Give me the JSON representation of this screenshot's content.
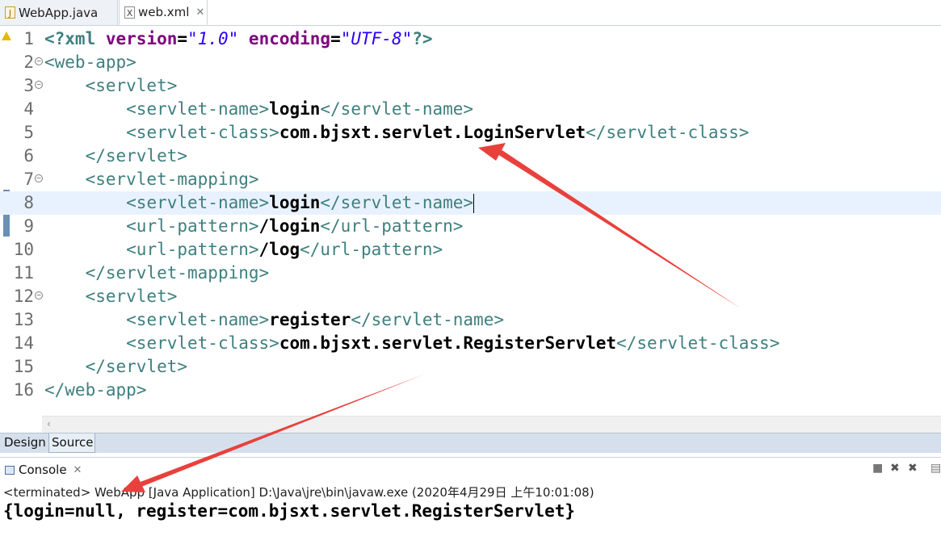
{
  "tabs": [
    {
      "label": "WebApp.java",
      "icon": "java-file-icon"
    },
    {
      "label": "web.xml",
      "icon": "xml-file-icon",
      "close": "✕"
    }
  ],
  "editor": {
    "lines": [
      {
        "num": "1",
        "html": "<span class=\"pi\">&lt;?xml</span> <span class=\"an\">version</span><span class=\"eq\">=</span><span class=\"av\">\"1.0\"</span> <span class=\"an\">encoding</span><span class=\"eq\">=</span><span class=\"av\">\"UTF-8\"</span><span class=\"pi\">?&gt;</span>"
      },
      {
        "num": "2",
        "fold": true,
        "html": "<span class=\"tg\">&lt;web-app&gt;</span>"
      },
      {
        "num": "3",
        "fold": true,
        "html": "    <span class=\"tg\">&lt;servlet&gt;</span>"
      },
      {
        "num": "4",
        "html": "        <span class=\"tg\">&lt;servlet-name&gt;</span><span class=\"tx\">login</span><span class=\"tg\">&lt;/servlet-name&gt;</span>"
      },
      {
        "num": "5",
        "html": "        <span class=\"tg\">&lt;servlet-class&gt;</span><span class=\"tx\">com.bjsxt.servlet.LoginServlet</span><span class=\"tg\">&lt;/servlet-class&gt;</span>"
      },
      {
        "num": "6",
        "html": "    <span class=\"tg\">&lt;/servlet&gt;</span>"
      },
      {
        "num": "7",
        "fold": true,
        "html": "    <span class=\"tg\">&lt;servlet-mapping&gt;</span>"
      },
      {
        "num": "8",
        "highlight": true,
        "html": "        <span class=\"tg\">&lt;servlet-name&gt;</span><span class=\"tx\">login</span><span class=\"tg\">&lt;/servlet-name&gt;</span><span class=\"cursor\"></span>"
      },
      {
        "num": "9",
        "html": "        <span class=\"tg\">&lt;url-pattern&gt;</span><span class=\"tx\">/login</span><span class=\"tg\">&lt;/url-pattern&gt;</span>"
      },
      {
        "num": "10",
        "html": "        <span class=\"tg\">&lt;url-pattern&gt;</span><span class=\"tx\">/log</span><span class=\"tg\">&lt;/url-pattern&gt;</span>"
      },
      {
        "num": "11",
        "html": "    <span class=\"tg\">&lt;/servlet-mapping&gt;</span>"
      },
      {
        "num": "12",
        "fold": true,
        "html": "    <span class=\"tg\">&lt;servlet&gt;</span>"
      },
      {
        "num": "13",
        "html": "        <span class=\"tg\">&lt;servlet-name&gt;</span><span class=\"tx\">register</span><span class=\"tg\">&lt;/servlet-name&gt;</span>"
      },
      {
        "num": "14",
        "html": "        <span class=\"tg\">&lt;servlet-class&gt;</span><span class=\"tx\">com.bjsxt.servlet.RegisterServlet</span><span class=\"tg\">&lt;/servlet-class&gt;</span>"
      },
      {
        "num": "15",
        "html": "    <span class=\"tg\">&lt;/servlet&gt;</span>"
      },
      {
        "num": "16",
        "html": "<span class=\"tg\">&lt;/web-app&gt;</span>"
      }
    ]
  },
  "page_tabs": {
    "design": "Design",
    "source": "Source"
  },
  "console": {
    "title": "Console",
    "close": "✕",
    "terminated": "<terminated> WebApp [Java Application] D:\\Java\\jre\\bin\\javaw.exe (2020年4月29日 上午10:01:08)",
    "output": "{login=null, register=com.bjsxt.servlet.RegisterServlet}"
  },
  "colors": {
    "tag": "#3f7f7f",
    "attr_name": "#7f007f",
    "attr_value": "#2a00ff",
    "highlight_line": "#e8f2fe",
    "annotation_arrow": "#e8413c"
  }
}
